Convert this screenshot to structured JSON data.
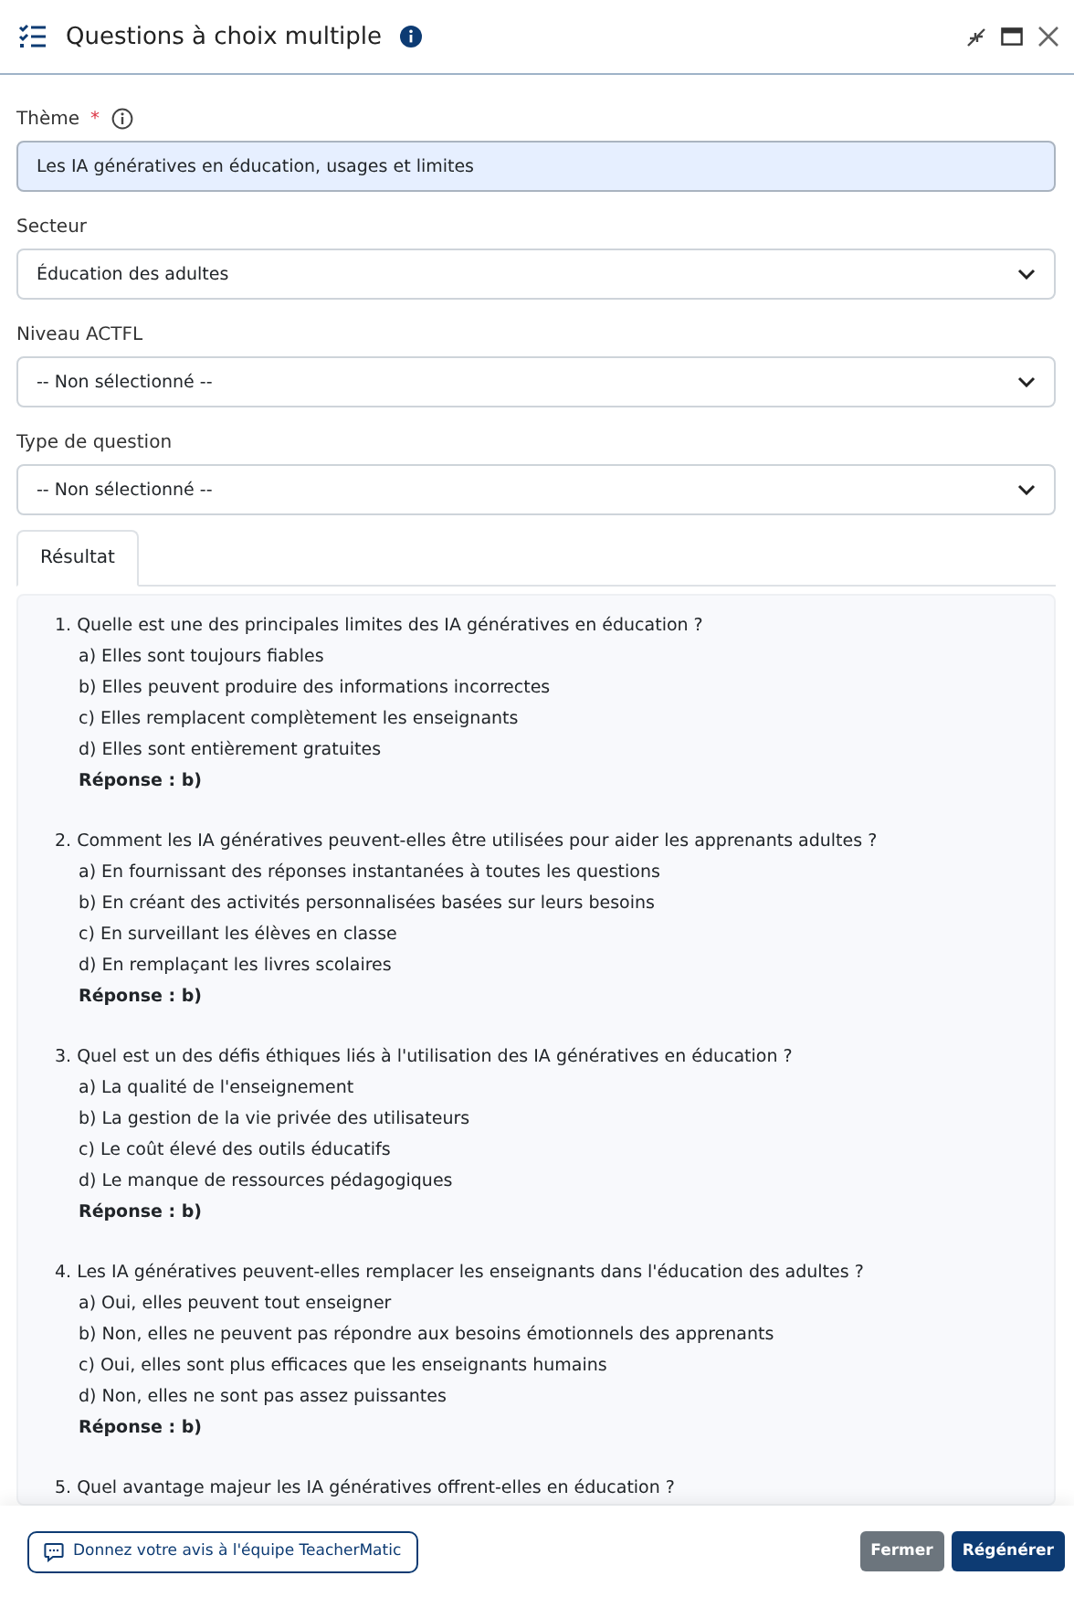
{
  "window": {
    "title": "Questions à choix multiple"
  },
  "fields": [
    {
      "kind": "text",
      "label": "Thème",
      "required_mark": "*",
      "info": true,
      "value": "Les IA génératives en éducation, usages et limites"
    },
    {
      "kind": "select",
      "label": "Secteur",
      "value": "Éducation des adultes"
    },
    {
      "kind": "select",
      "label": "Niveau ACTFL",
      "value": "-- Non sélectionné --"
    },
    {
      "kind": "select",
      "label": "Type de question",
      "value": "-- Non sélectionné --"
    }
  ],
  "tabs": [
    {
      "label": "Résultat",
      "selected": true
    }
  ],
  "questions": [
    {
      "number": "1.",
      "text": "Quelle est une des principales limites des IA génératives en éducation ?",
      "options": [
        "a) Elles sont toujours fiables",
        "b) Elles peuvent produire des informations incorrectes",
        "c) Elles remplacent complètement les enseignants",
        "d) Elles sont entièrement gratuites"
      ],
      "answer": "Réponse : b)"
    },
    {
      "number": "2.",
      "text": "Comment les IA génératives peuvent-elles être utilisées pour aider les apprenants adultes ?",
      "options": [
        "a) En fournissant des réponses instantanées à toutes les questions",
        "b) En créant des activités personnalisées basées sur leurs besoins",
        "c) En surveillant les élèves en classe",
        "d) En remplaçant les livres scolaires"
      ],
      "answer": "Réponse : b)"
    },
    {
      "number": "3.",
      "text": "Quel est un des défis éthiques liés à l'utilisation des IA génératives en éducation ?",
      "options": [
        "a) La qualité de l'enseignement",
        "b) La gestion de la vie privée des utilisateurs",
        "c) Le coût élevé des outils éducatifs",
        "d) Le manque de ressources pédagogiques"
      ],
      "answer": "Réponse : b)"
    },
    {
      "number": "4.",
      "text": "Les IA génératives peuvent-elles remplacer les enseignants dans l'éducation des adultes ?",
      "options": [
        "a) Oui, elles peuvent tout enseigner",
        "b) Non, elles ne peuvent pas répondre aux besoins émotionnels des apprenants",
        "c) Oui, elles sont plus efficaces que les enseignants humains",
        "d) Non, elles ne sont pas assez puissantes"
      ],
      "answer": "Réponse : b)"
    },
    {
      "number": "5.",
      "text": "Quel avantage majeur les IA génératives offrent-elles en éducation ?"
    }
  ],
  "footer": {
    "feedback": "Donnez votre avis à l'équipe TeacherMatic",
    "buttons": [
      {
        "kind": "secondary",
        "label": "Fermer"
      },
      {
        "kind": "primary",
        "label": "Régénérer"
      }
    ]
  }
}
